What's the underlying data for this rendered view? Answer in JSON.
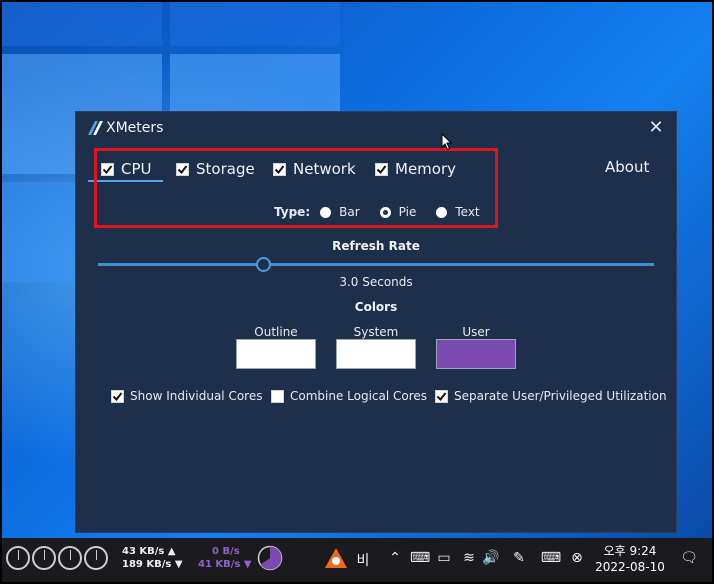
{
  "window": {
    "title": "XMeters",
    "close_symbol": "✕"
  },
  "tabs": [
    {
      "label": "CPU",
      "checked": true,
      "selected": true
    },
    {
      "label": "Storage",
      "checked": true,
      "selected": false
    },
    {
      "label": "Network",
      "checked": true,
      "selected": false
    },
    {
      "label": "Memory",
      "checked": true,
      "selected": false
    }
  ],
  "about_label": "About",
  "type_selector": {
    "label": "Type:",
    "options": [
      {
        "label": "Bar",
        "selected": false
      },
      {
        "label": "Pie",
        "selected": true
      },
      {
        "label": "Text",
        "selected": false
      }
    ]
  },
  "refresh_rate": {
    "title": "Refresh Rate",
    "value_label": "3.0 Seconds",
    "slider_fraction": 0.3
  },
  "colors": {
    "title": "Colors",
    "swatches": [
      {
        "label": "Outline",
        "color": "#ffffff"
      },
      {
        "label": "System",
        "color": "#ffffff"
      },
      {
        "label": "User",
        "color": "#7b4ab0"
      }
    ]
  },
  "options": [
    {
      "label": "Show Individual Cores",
      "checked": true
    },
    {
      "label": "Combine Logical Cores",
      "checked": false
    },
    {
      "label": "Separate User/Privileged Utilization",
      "checked": true
    }
  ],
  "taskbar": {
    "network_up": "43 KB/s ▲",
    "network_down": "189 KB/s ▼",
    "memory_up": "0 B/s",
    "memory_down": "41 KB/s ▼",
    "ime_label": "비",
    "clock_time": "오후 9:24",
    "clock_date": "2022-08-10"
  },
  "accent_colors": {
    "highlight": "#e0141e",
    "accent": "#4fa6e8",
    "window_bg": "#1e2f4c",
    "user_color": "#7b4ab0"
  }
}
